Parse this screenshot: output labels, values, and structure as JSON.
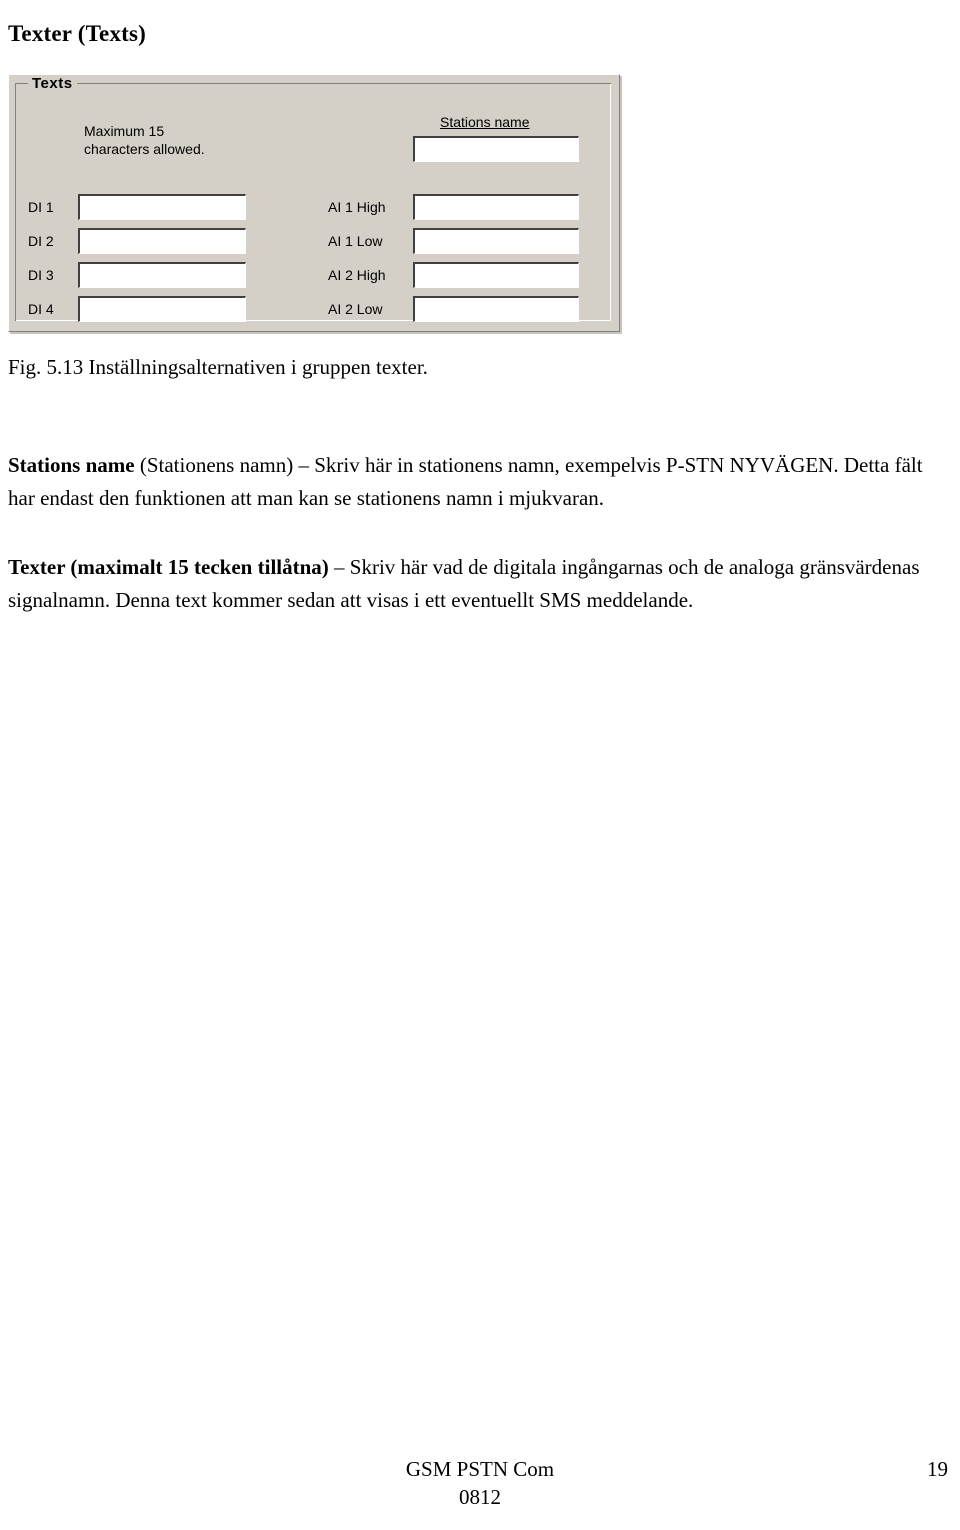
{
  "document": {
    "title": "Texter (Texts)",
    "figure_caption": "Fig. 5.13 Inställningsalternativen i gruppen texter."
  },
  "dialog": {
    "groupbox_legend": "Texts",
    "hint_text": "Maximum 15\ncharacters allowed.",
    "stations_name": {
      "label": "Stations name",
      "value": "",
      "placeholder": ""
    },
    "left_fields": [
      {
        "label": "DI 1",
        "value": "",
        "placeholder": ""
      },
      {
        "label": "DI 2",
        "value": "",
        "placeholder": ""
      },
      {
        "label": "DI 3",
        "value": "",
        "placeholder": ""
      },
      {
        "label": "DI 4",
        "value": "",
        "placeholder": ""
      }
    ],
    "right_fields": [
      {
        "label": "AI 1 High",
        "value": "",
        "placeholder": ""
      },
      {
        "label": "AI 1 Low",
        "value": "",
        "placeholder": ""
      },
      {
        "label": "AI 2 High",
        "value": "",
        "placeholder": ""
      },
      {
        "label": "AI 2 Low",
        "value": "",
        "placeholder": ""
      }
    ],
    "colors": {
      "face": "#d4d0c8",
      "shadow": "#808080",
      "highlight": "#ffffff",
      "field_background": "#ffffff",
      "text": "#000000"
    }
  },
  "body": {
    "paragraph_1": {
      "bold_lead": "Stations name",
      "rest": " (Stationens namn) – Skriv här in stationens namn, exempelvis P-STN NYVÄGEN. Detta fält har endast den funktionen att man kan se stationens namn i mjukvaran."
    },
    "paragraph_2": {
      "bold_lead": "Texter (maximalt 15 tecken tillåtna)",
      "rest": " – Skriv här vad de digitala ingångarnas och de analoga gränsvärdenas signalnamn. Denna text kommer sedan att visas i ett eventuellt SMS meddelande."
    }
  },
  "footer": {
    "product": "GSM PSTN Com",
    "code": "0812",
    "page_number": "19"
  }
}
